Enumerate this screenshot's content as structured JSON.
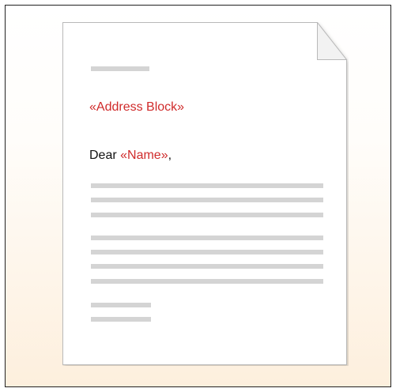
{
  "letter": {
    "address_field": "«Address Block»",
    "salutation": "Dear ",
    "name_field": "«Name»",
    "salutation_end": ","
  },
  "colors": {
    "merge_field": "#d02b2b",
    "placeholder_line": "#d4d4d4",
    "background_warm": "#fdefdd"
  },
  "icons": [
    "folded-corner-icon"
  ]
}
